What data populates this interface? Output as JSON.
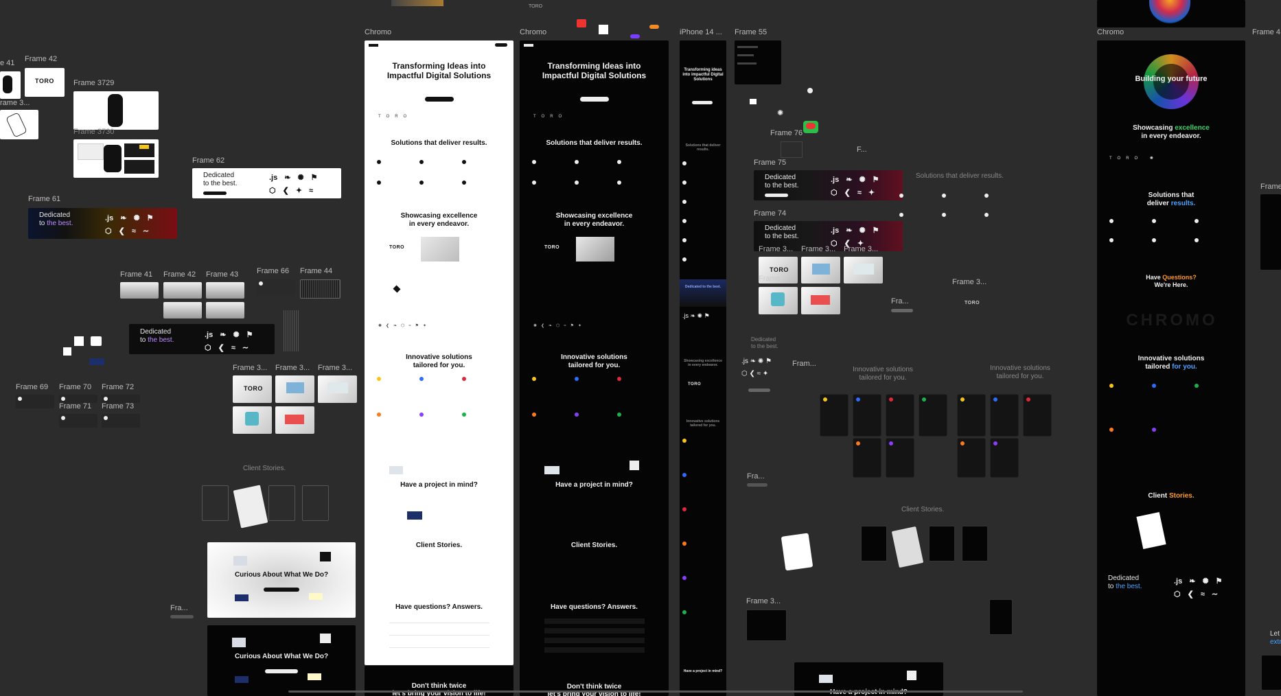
{
  "frames": {
    "f41": "Frame 41",
    "f42a": "Frame 42",
    "f3729": "Frame 3729",
    "f3a": "Frame 3...",
    "f3730": "Frame 3730",
    "f62": "Frame 62",
    "f61": "Frame 61",
    "f41b": "Frame 41",
    "f42b": "Frame 42",
    "f43": "Frame 43",
    "f66": "Frame 66",
    "f44": "Frame 44",
    "f3b": "Frame 3...",
    "f3c": "Frame 3...",
    "f3d": "Frame 3...",
    "f69": "Frame 69",
    "f70": "Frame 70",
    "f72": "Frame 72",
    "f71": "Frame 71",
    "f73": "Frame 73",
    "fraA": "Fra...",
    "chromo1": "Chromo",
    "chromo2": "Chromo",
    "iphone": "iPhone 14 ...",
    "f55": "Frame 55",
    "f76": "Frame 76",
    "f75a": "Frame 75",
    "f74": "Frame 74",
    "f3e": "Frame 3...",
    "f3f": "Frame 3...",
    "f3g": "Frame 3...",
    "f3h": "Frame 3",
    "fram": "Fram...",
    "fraB": "Fra...",
    "fraC": "Fra...",
    "f3i": "Frame 3...",
    "fF": "F...",
    "f75b": "Frame 75",
    "f3j": "Frame 3...",
    "chromo3": "Chromo",
    "f4x": "Frame 4",
    "fr41": "e 41",
    "fr3": "rame 3...",
    "frameRight": "Frame"
  },
  "brand": {
    "toro": "TORO",
    "js": ".js"
  },
  "dedicated": {
    "line1": "Dedicated",
    "line2a": "to ",
    "line2b": "the best.",
    "line2full": "to the best."
  },
  "lightSite": {
    "hero": "Transforming Ideas into Impactful Digital Solutions",
    "solutions": "Solutions that deliver results.",
    "showcase1": "Showcasing excellence",
    "showcase2": "in every endeavor.",
    "innov1": "Innovative solutions",
    "innov2": "tailored for you.",
    "project": "Have a project in mind?",
    "stories": "Client Stories.",
    "questions": "Have questions? Answers.",
    "footer1": "Don't think twice",
    "footer2": "let's bring your vision to life!"
  },
  "darkSite": {
    "hero": "Transforming Ideas into Impactful Digital Solutions",
    "solutions": "Solutions that deliver results.",
    "showcase1": "Showcasing excellence",
    "showcase2": "in every endeavor.",
    "innov1": "Innovative solutions",
    "innov2": "tailored for you.",
    "project": "Have a project in mind?",
    "stories": "Client Stories.",
    "questions": "Have questions? Answers.",
    "footer1": "Don't think twice",
    "footer2": "let's bring your vision to life!"
  },
  "mobile": {
    "hero": "Transforming ideas into impactful Digital Solutions",
    "solutions": "Solutions that deliver results.",
    "dedicated": "Dedicated to the best.",
    "showcase": "Showcasing excellence in every endeavor.",
    "innov": "Innovative solutions tailored for you.",
    "project": "Have a project in mind?"
  },
  "chromoRight": {
    "hero": "Building your future",
    "showcase1": "Showcasing ",
    "showcaseAcc": "excellence",
    "showcase2": "in every endeavor.",
    "sol1": "Solutions that",
    "sol2a": "deliver ",
    "sol2b": "results.",
    "q1": "Have ",
    "qAcc": "Questions?",
    "q2": "We're Here.",
    "innov1": "Innovative solutions",
    "innov2a": "tailored ",
    "innov2b": "for you.",
    "stories1": "Client ",
    "stories2": "Stories.",
    "watermark": "CHROMO"
  },
  "canvas": {
    "curious": "Curious About What We Do?",
    "clientStories": "Client Stories.",
    "solutionsAlt": "Solutions that deliver results.",
    "innovA1": "Innovative solutions",
    "innovA2": "tailored for you.",
    "innovB1": "Innovative solutions",
    "innovB2": "tailored for you.",
    "clientStories2": "Client Stories.",
    "projectBottom": "Have a project in mind?",
    "letsA": "Let",
    "letsB": "extra"
  },
  "colors": {
    "accent": "#b98cff",
    "green": "#3fd46b",
    "blue": "#4aa3ff",
    "orange": "#ff9a2e",
    "red": "#e1283b"
  }
}
